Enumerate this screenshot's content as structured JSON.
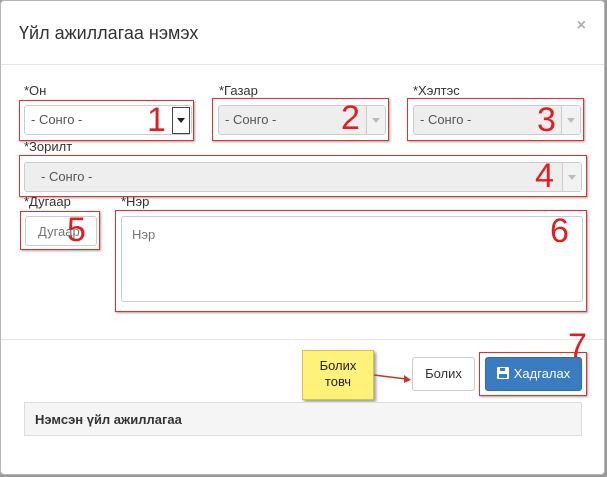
{
  "modal": {
    "title": "Үйл ажиллагаа нэмэх",
    "close": "×"
  },
  "form": {
    "year": {
      "label": "*Он",
      "value": "- Сонго -"
    },
    "place": {
      "label": "*Газар",
      "value": "- Сонго -"
    },
    "measure": {
      "label": "*Хэлтэс",
      "value": "- Сонго -"
    },
    "goal": {
      "label": "*Зорилт",
      "value": "- Сонго -"
    },
    "number": {
      "label": "*Дугаар",
      "placeholder": "Дугаар"
    },
    "name": {
      "label": "*Нэр",
      "placeholder": "Нэр"
    }
  },
  "annotations": {
    "markers": [
      "1",
      "2",
      "3",
      "4",
      "5",
      "6",
      "7"
    ],
    "callout": "Болих товч"
  },
  "footer": {
    "cancel_label": "Болих",
    "save_label": "Хадгалах"
  },
  "panel": {
    "title": "Нэмсэн үйл ажиллагаа"
  },
  "colors": {
    "annotation_red": "#e02020",
    "primary": "#3a7cbf",
    "callout_yellow": "#fff27a"
  }
}
